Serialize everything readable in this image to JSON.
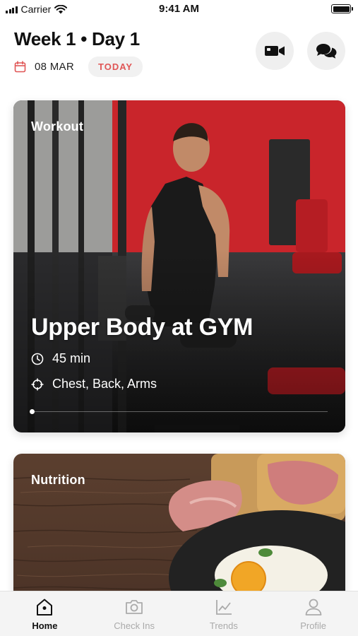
{
  "status_bar": {
    "carrier": "Carrier",
    "time": "9:41 AM",
    "battery_level": 1.0
  },
  "header": {
    "title": "Week 1 • Day 1",
    "date": "08 MAR",
    "today_badge": "TODAY",
    "video_button_icon": "video-camera-icon",
    "chat_button_icon": "chat-bubbles-icon"
  },
  "workout_card": {
    "label": "Workout",
    "title": "Upper Body at GYM",
    "duration": "45 min",
    "focus": "Chest, Back, Arms",
    "progress": 0.0,
    "duration_icon": "clock-icon",
    "focus_icon": "target-icon"
  },
  "nutrition_card": {
    "label": "Nutrition"
  },
  "tab_bar": {
    "items": [
      {
        "label": "Home",
        "icon": "home-icon",
        "active": true
      },
      {
        "label": "Check Ins",
        "icon": "camera-icon",
        "active": false
      },
      {
        "label": "Trends",
        "icon": "chart-icon",
        "active": false
      },
      {
        "label": "Profile",
        "icon": "user-icon",
        "active": false
      }
    ]
  },
  "colors": {
    "accent": "#e05656",
    "workout_wall": "#c9252b",
    "tab_active": "#111111",
    "tab_inactive": "#aaaaaa"
  }
}
